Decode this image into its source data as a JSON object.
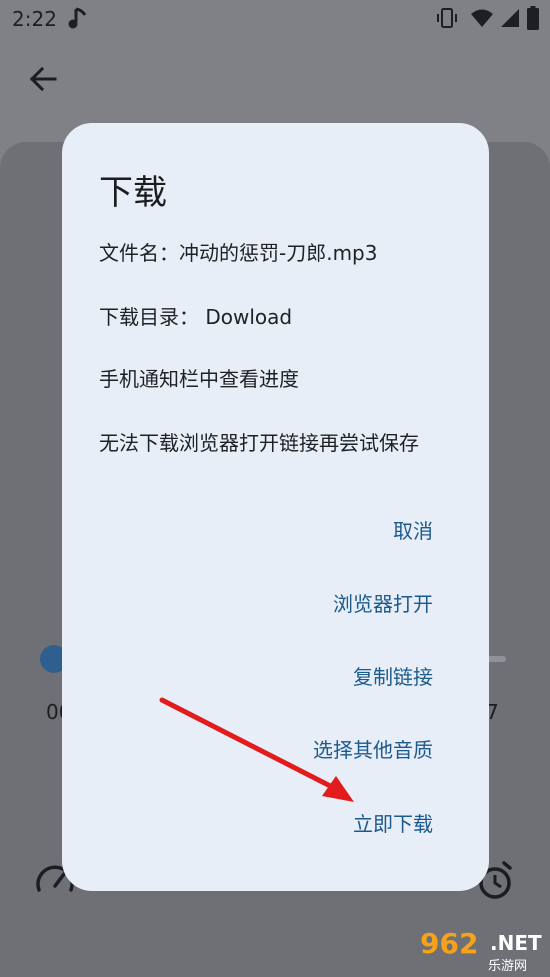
{
  "status_bar": {
    "time": "2:22"
  },
  "player_bg": {
    "time_left": "00",
    "time_right": "7"
  },
  "dialog": {
    "title": "下载",
    "filename_line": "文件名：冲动的惩罚-刀郎.mp3",
    "dir_line": "下载目录： Dowload",
    "notify_line": "手机通知栏中查看进度",
    "fallback_line": "无法下载浏览器打开链接再尝试保存",
    "actions": {
      "cancel": "取消",
      "open_browser": "浏览器打开",
      "copy_link": "复制链接",
      "other_quality": "选择其他音质",
      "download_now": "立即下载"
    }
  },
  "watermark": {
    "number": "962",
    "suffix": ".NET",
    "sub": "乐游网"
  },
  "colors": {
    "dialog_bg": "#e7eef8",
    "action_text": "#1d5a8c",
    "arrow": "#e21b1b",
    "scrim": "#7f8186"
  }
}
